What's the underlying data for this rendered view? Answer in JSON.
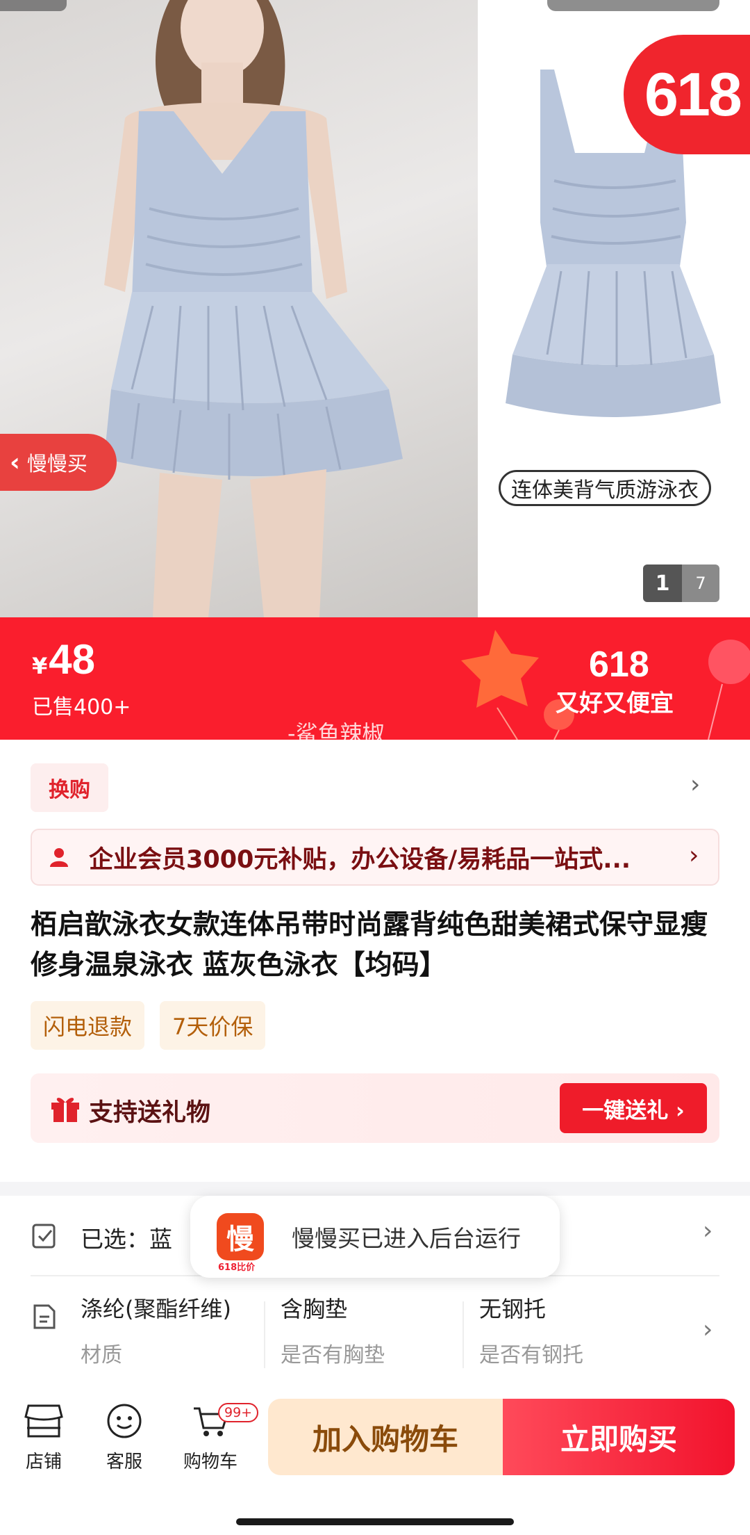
{
  "gallery": {
    "badge": "618",
    "caption": "连体美背气质游泳衣",
    "back_label": "慢慢买",
    "index": "1",
    "total": "7"
  },
  "price": {
    "currency": "¥",
    "amount": "48",
    "sold": "已售400+",
    "promo_title": "618",
    "promo_sub": "又好又便宜",
    "seller": "-鲨鱼辣椒"
  },
  "exchange": {
    "label": "换购"
  },
  "enterprise": {
    "text": "企业会员3000元补贴，办公设备/易耗品一站式..."
  },
  "product": {
    "title": "栢启歆泳衣女款连体吊带时尚露背纯色甜美裙式保守显瘦修身温泉泳衣 蓝灰色泳衣【均码】",
    "service_tags": [
      "闪电退款",
      "7天价保"
    ]
  },
  "gift": {
    "label": "支持送礼物",
    "button": "一键送礼 ›"
  },
  "selection": {
    "label": "已选：蓝"
  },
  "toast": {
    "logo_char": "慢",
    "logo_sub": "618比价",
    "message": "慢慢买已进入后台运行"
  },
  "attributes": [
    {
      "value": "涤纶(聚酯纤维)",
      "key": "材质"
    },
    {
      "value": "含胸垫",
      "key": "是否有胸垫"
    },
    {
      "value": "无钢托",
      "key": "是否有钢托"
    }
  ],
  "bottom_bar": {
    "shop": "店铺",
    "service": "客服",
    "cart": "购物车",
    "cart_count": "99+",
    "add_to_cart": "加入购物车",
    "buy_now": "立即购买"
  },
  "colors": {
    "brand_red": "#fa1e2d",
    "swimsuit_blue": "#b9c6dc"
  }
}
